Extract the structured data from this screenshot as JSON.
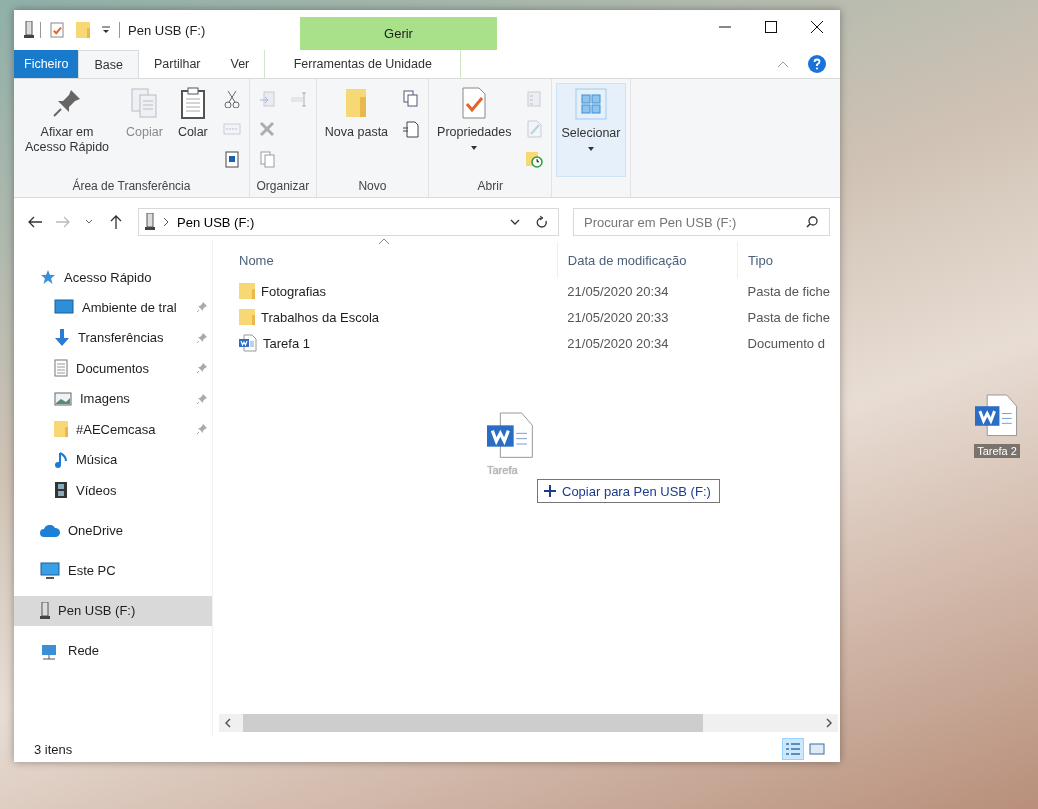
{
  "window": {
    "title": "Pen USB (F:)",
    "context_group": "Gerir"
  },
  "tabs": [
    {
      "label": "Ficheiro",
      "kind": "file",
      "selected": false
    },
    {
      "label": "Base",
      "kind": "normal",
      "selected": true
    },
    {
      "label": "Partilhar",
      "kind": "normal",
      "selected": false
    },
    {
      "label": "Ver",
      "kind": "normal",
      "selected": false
    },
    {
      "label": "Ferramentas de Unidade",
      "kind": "context",
      "selected": false
    }
  ],
  "ribbon": {
    "groups": [
      {
        "label": "Área de Transferência",
        "commands": [
          {
            "kind": "large",
            "label": "Afixar em Acesso Rápido",
            "disabled": false,
            "dropdown": false,
            "highlighted": false
          },
          {
            "kind": "large",
            "label": "Copiar",
            "disabled": true,
            "dropdown": false,
            "highlighted": false
          },
          {
            "kind": "large",
            "label": "Colar",
            "disabled": false,
            "dropdown": false,
            "highlighted": false
          },
          {
            "kind": "small",
            "disabled": false
          },
          {
            "kind": "small",
            "disabled": true
          },
          {
            "kind": "small",
            "disabled": false
          }
        ]
      },
      {
        "label": "Organizar",
        "commands": [
          {
            "kind": "small",
            "disabled": true
          },
          {
            "kind": "small",
            "disabled": true
          },
          {
            "kind": "small",
            "disabled": false
          },
          {
            "kind": "small",
            "disabled": true
          }
        ]
      },
      {
        "label": "Novo",
        "commands": [
          {
            "kind": "large",
            "label": "Nova pasta",
            "disabled": false,
            "dropdown": false,
            "highlighted": false
          },
          {
            "kind": "small",
            "disabled": false
          },
          {
            "kind": "small",
            "disabled": false
          }
        ]
      },
      {
        "label": "Abrir",
        "commands": [
          {
            "kind": "large",
            "label": "Propriedades",
            "disabled": false,
            "dropdown": true,
            "highlighted": false
          },
          {
            "kind": "small",
            "disabled": true
          },
          {
            "kind": "small",
            "disabled": true
          },
          {
            "kind": "small",
            "disabled": false
          }
        ]
      },
      {
        "commands": [
          {
            "kind": "large",
            "label": "Selecionar",
            "disabled": false,
            "dropdown": true,
            "highlighted": true
          }
        ]
      }
    ]
  },
  "address": {
    "path": "Pen USB (F:)"
  },
  "search": {
    "placeholder": "Procurar em Pen USB (F:)"
  },
  "navigation": [
    {
      "label": "Acesso Rápido",
      "selected": false,
      "children": [
        {
          "label": "Ambiente de tral",
          "pinned": true,
          "selected": false
        },
        {
          "label": "Transferências",
          "pinned": true,
          "selected": false
        },
        {
          "label": "Documentos",
          "pinned": true,
          "selected": false
        },
        {
          "label": "Imagens",
          "pinned": true,
          "selected": false
        },
        {
          "label": "#AECemcasa",
          "pinned": true,
          "selected": false
        },
        {
          "label": "Música",
          "pinned": false,
          "selected": false
        },
        {
          "label": "Vídeos",
          "pinned": false,
          "selected": false
        }
      ]
    },
    {
      "label": "OneDrive",
      "selected": false
    },
    {
      "label": "Este PC",
      "selected": false
    },
    {
      "label": "Pen USB (F:)",
      "selected": true
    },
    {
      "label": "Rede",
      "selected": false
    }
  ],
  "table": {
    "columns": [
      "Nome",
      "Data de modificação",
      "Tipo"
    ],
    "rows": [
      {
        "kind": "folder",
        "cells": [
          "Fotografias",
          "21/05/2020 20:34",
          "Pasta de fiche"
        ]
      },
      {
        "kind": "folder",
        "cells": [
          "Trabalhos da Escola",
          "21/05/2020 20:33",
          "Pasta de fiche"
        ]
      },
      {
        "kind": "word",
        "cells": [
          "Tarefa 1",
          "21/05/2020 20:34",
          "Documento d"
        ]
      }
    ]
  },
  "drag": {
    "label": "Tarefa",
    "tooltip": "Copiar para Pen USB (F:)"
  },
  "status_bar": {
    "text": "3 itens",
    "views": [
      {
        "kind": "details",
        "selected": true
      },
      {
        "kind": "large_icons",
        "selected": false
      }
    ]
  },
  "desktop_icons": [
    {
      "label": "Tarefa 2"
    }
  ]
}
